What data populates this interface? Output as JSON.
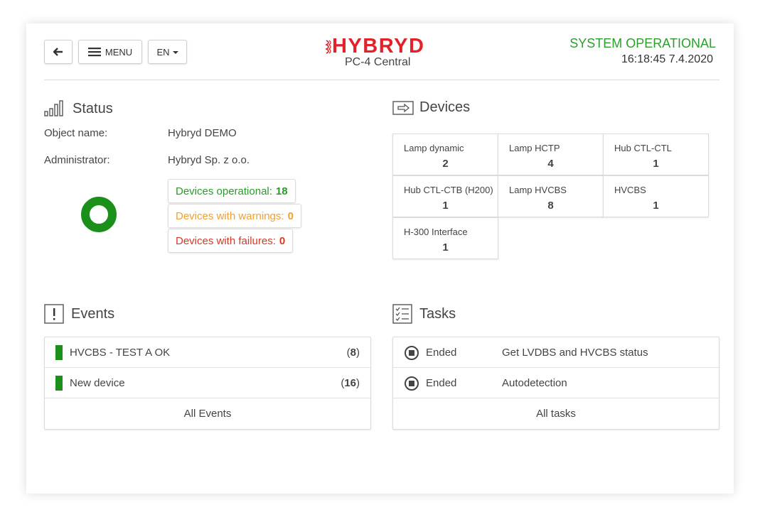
{
  "header": {
    "menu_label": "MENU",
    "lang_label": "EN",
    "logo_text": "HYBRYD",
    "logo_subtitle": "PC-4 Central",
    "system_status": "SYSTEM OPERATIONAL",
    "datetime": "16:18:45 7.4.2020",
    "status_color": "#2e9d2e",
    "brand_color": "#e2222a"
  },
  "status": {
    "title": "Status",
    "object_label": "Object name:",
    "object_value": "Hybryd DEMO",
    "admin_label": "Administrator:",
    "admin_value": "Hybryd Sp. z o.o.",
    "operational_label": "Devices operational:",
    "operational_count": "18",
    "warnings_label": "Devices with warnings:",
    "warnings_count": "0",
    "failures_label": "Devices with failures:",
    "failures_count": "0"
  },
  "devices": {
    "title": "Devices",
    "items": [
      {
        "name": "Lamp dynamic",
        "count": "2"
      },
      {
        "name": "Lamp HCTP",
        "count": "4"
      },
      {
        "name": "Hub CTL-CTL",
        "count": "1"
      },
      {
        "name": "Hub CTL-CTB (H200)",
        "count": "1"
      },
      {
        "name": "Lamp HVCBS",
        "count": "8"
      },
      {
        "name": "HVCBS",
        "count": "1"
      },
      {
        "name": "H-300 Interface",
        "count": "1"
      }
    ]
  },
  "events": {
    "title": "Events",
    "items": [
      {
        "title": "HVCBS - TEST A OK",
        "count": "8"
      },
      {
        "title": "New device",
        "count": "16"
      }
    ],
    "all_label": "All Events"
  },
  "tasks": {
    "title": "Tasks",
    "items": [
      {
        "state": "Ended",
        "name": "Get LVDBS and HVCBS status"
      },
      {
        "state": "Ended",
        "name": "Autodetection"
      }
    ],
    "all_label": "All tasks"
  }
}
